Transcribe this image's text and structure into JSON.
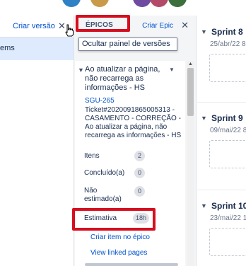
{
  "colors": {
    "link": "#0052cc",
    "highlight": "#d50f1f",
    "selected_row": "#deebff",
    "avatars": [
      "#2f80c4",
      "#c99a4a",
      "#6e4aa0",
      "#b44a6a",
      "#3d6f3d"
    ]
  },
  "left_panel": {
    "create_version": "Criar versão",
    "close_symbol": "✕",
    "selected_item": "ems"
  },
  "epic_panel": {
    "tab_label": "ÉPICOS",
    "create_epic": "Criar Epic",
    "close_symbol": "✕",
    "tooltip": "Ocultar painel de versões",
    "epic": {
      "chevron": "▼",
      "title": "Ao atualizar a página, não recarrega as informações - HS",
      "menu": "▼",
      "key": "SGU-265",
      "description": "Ticket#2020091865005313 - CASAMENTO - CORREÇÃO - Ao atualizar a página, não recarrega as informações - HS",
      "stats": [
        {
          "label": "Itens",
          "value": "2"
        },
        {
          "label": "Concluído(a)",
          "value": "0"
        },
        {
          "label": "Não estimado(a)",
          "value": "0"
        },
        {
          "label": "Estimativa",
          "value": "18h"
        }
      ],
      "create_item": "Criar item no épico",
      "linked_pages": "View linked pages"
    }
  },
  "sprints": [
    {
      "name": "Sprint 8",
      "date": "25/abr/22 8",
      "chevron": "▼"
    },
    {
      "name": "Sprint 9",
      "date": "09/mai/22 8",
      "chevron": "▼"
    },
    {
      "name": "Sprint 10",
      "date": "23/mai/22 1",
      "chevron": "▼"
    }
  ]
}
